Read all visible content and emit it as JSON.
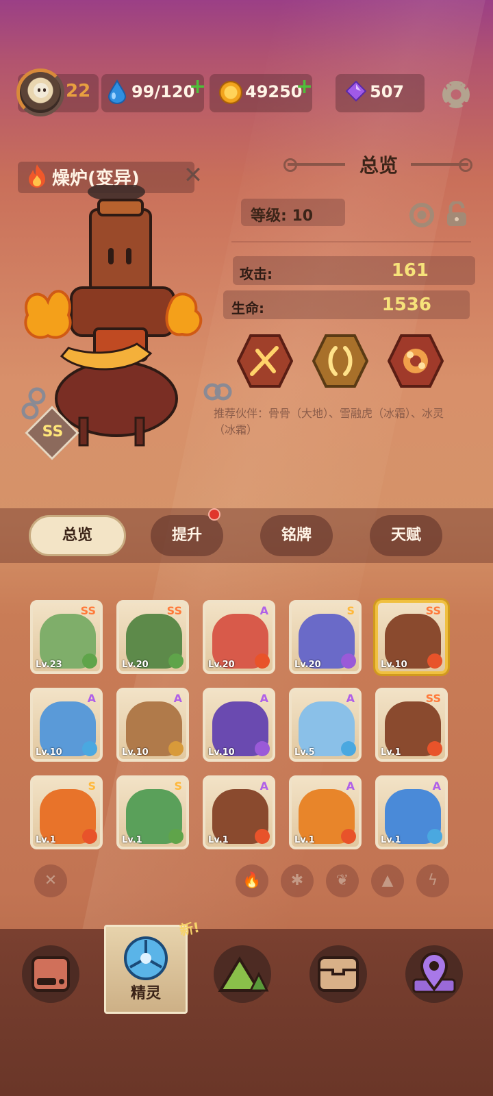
{
  "topbar": {
    "player_level": "22",
    "stamina": "99/120",
    "coins": "49250",
    "gems": "507"
  },
  "pet": {
    "name": "燥炉(变异)",
    "rank": "SS",
    "section_title": "总览",
    "level_label": "等级: 10",
    "attack_label": "攻击:",
    "attack_value": "161",
    "hp_label": "生命:",
    "hp_value": "1536",
    "recommend": "推荐伙伴：骨骨（大地）、雪融虎（冰霜）、冰灵（冰霜）"
  },
  "tabs": [
    "总览",
    "提升",
    "铭牌",
    "天赋"
  ],
  "roster": [
    {
      "rank": "SS",
      "lv": "Lv.23",
      "color": "#7fae6a",
      "elem": "#5fa44a"
    },
    {
      "rank": "SS",
      "lv": "Lv.20",
      "color": "#5d8a4a",
      "elem": "#5fa44a"
    },
    {
      "rank": "A",
      "lv": "Lv.20",
      "color": "#d85a4a",
      "elem": "#e8532a"
    },
    {
      "rank": "S",
      "lv": "Lv.20",
      "color": "#6a6ac8",
      "elem": "#9a5ad8"
    },
    {
      "rank": "SS",
      "lv": "Lv.10",
      "color": "#8a4a2e",
      "elem": "#e8532a"
    },
    {
      "rank": "A",
      "lv": "Lv.10",
      "color": "#5a9ad8",
      "elem": "#4aa8e0"
    },
    {
      "rank": "A",
      "lv": "Lv.10",
      "color": "#b07a4a",
      "elem": "#d89a3a"
    },
    {
      "rank": "A",
      "lv": "Lv.10",
      "color": "#6a4ab0",
      "elem": "#9a5ad8"
    },
    {
      "rank": "A",
      "lv": "Lv.5",
      "color": "#8ac0e8",
      "elem": "#4aa8e0"
    },
    {
      "rank": "SS",
      "lv": "Lv.1",
      "color": "#8a4a2e",
      "elem": "#e8532a"
    },
    {
      "rank": "S",
      "lv": "Lv.1",
      "color": "#e8732a",
      "elem": "#e8532a"
    },
    {
      "rank": "S",
      "lv": "Lv.1",
      "color": "#5aa05a",
      "elem": "#5fa44a"
    },
    {
      "rank": "A",
      "lv": "Lv.1",
      "color": "#8a4a2e",
      "elem": "#e8532a"
    },
    {
      "rank": "A",
      "lv": "Lv.1",
      "color": "#e8852a",
      "elem": "#e8532a"
    },
    {
      "rank": "A",
      "lv": "Lv.1",
      "color": "#4a8ad8",
      "elem": "#4aa8e0"
    }
  ],
  "nav": {
    "active_label": "精灵",
    "new_badge": "新!"
  }
}
